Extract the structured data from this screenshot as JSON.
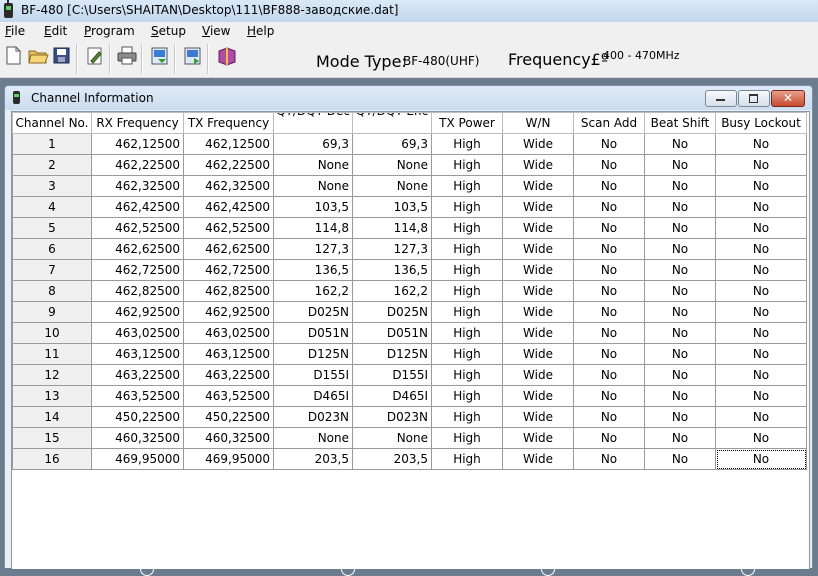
{
  "window": {
    "title": "BF-480 [C:\\Users\\SHAITAN\\Desktop\\111\\BF888-заводские.dat]"
  },
  "menu": [
    {
      "ul": "F",
      "rest": "ile"
    },
    {
      "ul": "E",
      "rest": "dit"
    },
    {
      "ul": "P",
      "rest": "rogram"
    },
    {
      "ul": "S",
      "rest": "etup"
    },
    {
      "ul": "V",
      "rest": "iew"
    },
    {
      "ul": "H",
      "rest": "elp"
    }
  ],
  "toolbar": {
    "icons": [
      "new-file-icon",
      "open-folder-icon",
      "save-icon",
      "edit-icon",
      "print-icon",
      "read-from-radio-icon",
      "write-to-radio-icon",
      "book-icon"
    ],
    "mode_label": "Mode Type:",
    "mode_value": "BF-480(UHF)",
    "freq_label": "Frequency£º",
    "freq_value": "400 - 470MHz"
  },
  "child": {
    "title": "Channel Information",
    "close_glyph": "✕"
  },
  "table": {
    "headers": [
      "Channel No.",
      "RX Frequency",
      "TX Frequency",
      "QT/DQT Dec",
      "QT/DQT Enc",
      "TX Power",
      "W/N",
      "Scan Add",
      "Beat Shift",
      "Busy Lockout"
    ],
    "rows": [
      [
        "1",
        "462,12500",
        "462,12500",
        "69,3",
        "69,3",
        "High",
        "Wide",
        "No",
        "No",
        "No"
      ],
      [
        "2",
        "462,22500",
        "462,22500",
        "None",
        "None",
        "High",
        "Wide",
        "No",
        "No",
        "No"
      ],
      [
        "3",
        "462,32500",
        "462,32500",
        "None",
        "None",
        "High",
        "Wide",
        "No",
        "No",
        "No"
      ],
      [
        "4",
        "462,42500",
        "462,42500",
        "103,5",
        "103,5",
        "High",
        "Wide",
        "No",
        "No",
        "No"
      ],
      [
        "5",
        "462,52500",
        "462,52500",
        "114,8",
        "114,8",
        "High",
        "Wide",
        "No",
        "No",
        "No"
      ],
      [
        "6",
        "462,62500",
        "462,62500",
        "127,3",
        "127,3",
        "High",
        "Wide",
        "No",
        "No",
        "No"
      ],
      [
        "7",
        "462,72500",
        "462,72500",
        "136,5",
        "136,5",
        "High",
        "Wide",
        "No",
        "No",
        "No"
      ],
      [
        "8",
        "462,82500",
        "462,82500",
        "162,2",
        "162,2",
        "High",
        "Wide",
        "No",
        "No",
        "No"
      ],
      [
        "9",
        "462,92500",
        "462,92500",
        "D025N",
        "D025N",
        "High",
        "Wide",
        "No",
        "No",
        "No"
      ],
      [
        "10",
        "463,02500",
        "463,02500",
        "D051N",
        "D051N",
        "High",
        "Wide",
        "No",
        "No",
        "No"
      ],
      [
        "11",
        "463,12500",
        "463,12500",
        "D125N",
        "D125N",
        "High",
        "Wide",
        "No",
        "No",
        "No"
      ],
      [
        "12",
        "463,22500",
        "463,22500",
        "D155I",
        "D155I",
        "High",
        "Wide",
        "No",
        "No",
        "No"
      ],
      [
        "13",
        "463,52500",
        "463,52500",
        "D465I",
        "D465I",
        "High",
        "Wide",
        "No",
        "No",
        "No"
      ],
      [
        "14",
        "450,22500",
        "450,22500",
        "D023N",
        "D023N",
        "High",
        "Wide",
        "No",
        "No",
        "No"
      ],
      [
        "15",
        "460,32500",
        "460,32500",
        "None",
        "None",
        "High",
        "Wide",
        "No",
        "No",
        "No"
      ],
      [
        "16",
        "469,95000",
        "469,95000",
        "203,5",
        "203,5",
        "High",
        "Wide",
        "No",
        "No",
        "No"
      ]
    ],
    "selected_row": 15,
    "selected_col": 9
  }
}
